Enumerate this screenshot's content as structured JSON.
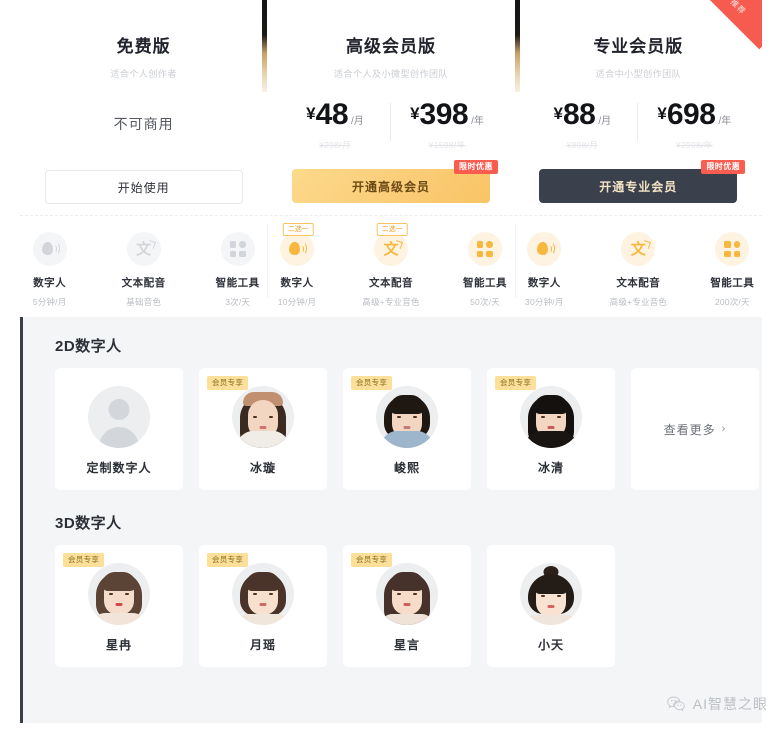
{
  "pricing": {
    "plans": [
      {
        "title": "免费版",
        "subtitle": "适合个人创作者",
        "free_note": "不可商用",
        "cta_label": "开始使用",
        "cta_badge": "",
        "ribbon": "",
        "prices": []
      },
      {
        "title": "高级会员版",
        "subtitle": "适合个人及小微型创作团队",
        "free_note": "",
        "cta_label": "开通高级会员",
        "cta_badge": "限时优惠",
        "ribbon": "",
        "prices": [
          {
            "currency": "¥",
            "amount": "48",
            "unit": "/月",
            "old": "¥298/月"
          },
          {
            "currency": "¥",
            "amount": "398",
            "unit": "/年",
            "old": "¥1598/年"
          }
        ]
      },
      {
        "title": "专业会员版",
        "subtitle": "适合中小型创作团队",
        "free_note": "",
        "cta_label": "开通专业会员",
        "cta_badge": "限时优惠",
        "ribbon": "推荐",
        "prices": [
          {
            "currency": "¥",
            "amount": "88",
            "unit": "/月",
            "old": "¥398/月"
          },
          {
            "currency": "¥",
            "amount": "698",
            "unit": "/年",
            "old": "¥2998/年"
          }
        ]
      }
    ],
    "features": [
      {
        "items": [
          {
            "icon": "digital-human-icon",
            "name": "数字人",
            "quota": "5分钟/月",
            "tag": ""
          },
          {
            "icon": "text-to-speech-icon",
            "name": "文本配音",
            "quota": "基础音色",
            "tag": ""
          },
          {
            "icon": "smart-tools-icon",
            "name": "智能工具",
            "quota": "3次/天",
            "tag": ""
          }
        ]
      },
      {
        "items": [
          {
            "icon": "digital-human-icon",
            "name": "数字人",
            "quota": "10分钟/月",
            "tag": "二选一"
          },
          {
            "icon": "text-to-speech-icon",
            "name": "文本配音",
            "quota": "高级+专业音色",
            "tag": "二选一"
          },
          {
            "icon": "smart-tools-icon",
            "name": "智能工具",
            "quota": "50次/天",
            "tag": ""
          }
        ]
      },
      {
        "items": [
          {
            "icon": "digital-human-icon",
            "name": "数字人",
            "quota": "30分钟/月",
            "tag": ""
          },
          {
            "icon": "text-to-speech-icon",
            "name": "文本配音",
            "quota": "高级+专业音色",
            "tag": ""
          },
          {
            "icon": "smart-tools-icon",
            "name": "智能工具",
            "quota": "200次/天",
            "tag": ""
          }
        ]
      }
    ]
  },
  "avatars": {
    "section_2d_title": "2D数字人",
    "section_3d_title": "3D数字人",
    "vip_tag": "会员专享",
    "more_label": "查看更多",
    "more_chevron": "›",
    "list_2d": [
      {
        "name": "定制数字人",
        "vip": false,
        "kind": "placeholder"
      },
      {
        "name": "冰璇",
        "vip": true,
        "kind": "photo-hat"
      },
      {
        "name": "峻熙",
        "vip": true,
        "kind": "photo-male"
      },
      {
        "name": "冰清",
        "vip": true,
        "kind": "photo-female"
      }
    ],
    "list_3d": [
      {
        "name": "星冉",
        "vip": true,
        "kind": "cg-brown"
      },
      {
        "name": "月瑶",
        "vip": true,
        "kind": "cg-short"
      },
      {
        "name": "星言",
        "vip": true,
        "kind": "cg-long"
      },
      {
        "name": "小天",
        "vip": false,
        "kind": "cg-bun"
      }
    ]
  },
  "watermark": {
    "icon": "wechat-icon",
    "text": "AI智慧之眼"
  },
  "colors": {
    "accent_gold": "#f8b83f",
    "accent_red": "#fb5c50",
    "dark_button": "#3a404c",
    "panel_bg": "#f4f5f7"
  }
}
